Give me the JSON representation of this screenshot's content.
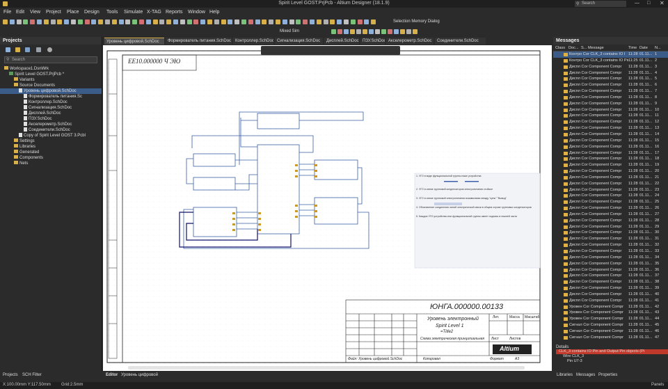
{
  "window": {
    "title": "Spirit Level GOST.PrjPcb - Altium Designer (18.1.9)",
    "search_label": "Search"
  },
  "menu": [
    "File",
    "Edit",
    "View",
    "Project",
    "Place",
    "Design",
    "Tools",
    "Simulate",
    "X-TAG",
    "Reports",
    "Window",
    "Help"
  ],
  "toolbar": {
    "selection_memory": "Selection Memory Dialog",
    "mixed_sim": "Mixed Sim"
  },
  "projects_panel": {
    "title": "Projects",
    "search_placeholder": "Search",
    "tree": [
      {
        "label": "Workspace1.DsnWrk",
        "indent": 0,
        "type": "ws"
      },
      {
        "label": "Spirit Level GOST.PrjPcb *",
        "indent": 1,
        "type": "proj"
      },
      {
        "label": "Variants",
        "indent": 2,
        "type": "folder"
      },
      {
        "label": "Source Documents",
        "indent": 2,
        "type": "folder"
      },
      {
        "label": "Уровень цифровой.SchDoc",
        "indent": 3,
        "type": "doc",
        "selected": true
      },
      {
        "label": "Формирователь питания.Sc",
        "indent": 4,
        "type": "doc"
      },
      {
        "label": "Контроллер.SchDoc",
        "indent": 4,
        "type": "doc"
      },
      {
        "label": "Сигнализация.SchDoc",
        "indent": 4,
        "type": "doc"
      },
      {
        "label": "Дисплей.SchDoc",
        "indent": 4,
        "type": "doc"
      },
      {
        "label": "ПЗУ.SchDoc",
        "indent": 4,
        "type": "doc"
      },
      {
        "label": "Акселерометр.SchDoc",
        "indent": 4,
        "type": "doc"
      },
      {
        "label": "Соединители.SchDoc",
        "indent": 4,
        "type": "doc"
      },
      {
        "label": "Copy of Spirit Level GOST 3.Pcbl",
        "indent": 3,
        "type": "doc"
      },
      {
        "label": "Settings",
        "indent": 2,
        "type": "folder"
      },
      {
        "label": "Libraries",
        "indent": 2,
        "type": "folder"
      },
      {
        "label": "Generated",
        "indent": 2,
        "type": "folder"
      },
      {
        "label": "Components",
        "indent": 2,
        "type": "folder"
      },
      {
        "label": "Nets",
        "indent": 2,
        "type": "folder"
      }
    ]
  },
  "doc_tabs": [
    "Уровень цифровой.SchDoc",
    "Формирователь питания.SchDoc",
    "Контроллер.SchDoc",
    "Сигнализация.SchDoc",
    "Дисплей.SchDoc",
    "ПЗУ.SchDoc",
    "Акселерометр.SchDoc",
    "Соединители.SchDoc"
  ],
  "sheet": {
    "doc_code_rot": "ЕЕ10.000000 Ч ЭЮ",
    "title_block_code": "ЮНГА.000000.00133",
    "title_name": "Уровень электронный",
    "title_sub": "Spirit Level 1",
    "title_file": "=Title2",
    "title_desc": "Схема электрическая принципиальная",
    "col_lit": "Лит.",
    "col_mass": "Масса",
    "col_scale": "Масштаб",
    "col_sheet": "Лист",
    "col_sheets": "Листов",
    "logo": "Altium",
    "footer_file": "Файл: Уровень цифровой.SchDoc",
    "footer_copied": "Копировал",
    "footer_format": "Формат",
    "footer_format_val": "A3",
    "notes": [
      "1. УГО в виде функциональной группы ниже устройства",
      "2. УГО в схеме групповой конденсаторов электропитания стойкое",
      "3. УГО в схеме групповой электропитания взаимосвязи между \"цепь\" \"Вывод\"",
      "4. Обозначение соединения линий электрической связи в общем случае групповых конденсаторов",
      "5. Каждое УГО устройства или функциональной группы имеет подпись в нижней части"
    ]
  },
  "messages_panel": {
    "title": "Messages",
    "columns": [
      "Class",
      "Doc...",
      "S...",
      "Message",
      "Time",
      "Date",
      "N..."
    ],
    "rows": [
      {
        "msg": "Контро Cor CLK_3 contains IO I",
        "time": "11:28",
        "date": "01.11...",
        "no": "1"
      },
      {
        "msg": "Контро Cor CLK_3 contains IO Pin",
        "time": "11:25",
        "date": "01.11...",
        "no": "2"
      },
      {
        "msg": "Диспл Cor Component Compr",
        "time": "11:28",
        "date": "01.11...",
        "no": "3"
      },
      {
        "msg": "Диспл Cor Component Compr",
        "time": "11:28",
        "date": "01.11...",
        "no": "4"
      },
      {
        "msg": "Диспл Cor Component Compr",
        "time": "11:28",
        "date": "01.11...",
        "no": "5"
      },
      {
        "msg": "Диспл Cor Component Compr",
        "time": "11:28",
        "date": "01.11...",
        "no": "6"
      },
      {
        "msg": "Диспл Cor Component Compr",
        "time": "11:28",
        "date": "01.11...",
        "no": "7"
      },
      {
        "msg": "Диспл Cor Component Compr",
        "time": "11:28",
        "date": "01.11...",
        "no": "8"
      },
      {
        "msg": "Диспл Cor Component Compr",
        "time": "11:28",
        "date": "01.11...",
        "no": "9"
      },
      {
        "msg": "Диспл Cor Component Compr",
        "time": "11:28",
        "date": "01.11...",
        "no": "10"
      },
      {
        "msg": "Диспл Cor Component Compr",
        "time": "11:28",
        "date": "01.11...",
        "no": "11"
      },
      {
        "msg": "Диспл Cor Component Compr",
        "time": "11:28",
        "date": "01.11...",
        "no": "12"
      },
      {
        "msg": "Диспл Cor Component Compr",
        "time": "11:28",
        "date": "01.11...",
        "no": "13"
      },
      {
        "msg": "Диспл Cor Component Compr",
        "time": "11:28",
        "date": "01.11...",
        "no": "14"
      },
      {
        "msg": "Диспл Cor Component Compr",
        "time": "11:28",
        "date": "01.11...",
        "no": "15"
      },
      {
        "msg": "Диспл Cor Component Compr",
        "time": "11:28",
        "date": "01.11...",
        "no": "16"
      },
      {
        "msg": "Диспл Cor Component Compr",
        "time": "11:28",
        "date": "01.11...",
        "no": "17"
      },
      {
        "msg": "Диспл Cor Component Compr",
        "time": "11:28",
        "date": "01.11...",
        "no": "18"
      },
      {
        "msg": "Диспл Cor Component Compr",
        "time": "11:28",
        "date": "01.11...",
        "no": "19"
      },
      {
        "msg": "Диспл Cor Component Compr",
        "time": "11:28",
        "date": "01.11...",
        "no": "20"
      },
      {
        "msg": "Диспл Cor Component Compr",
        "time": "11:28",
        "date": "01.11...",
        "no": "21"
      },
      {
        "msg": "Диспл Cor Component Compr",
        "time": "11:28",
        "date": "01.11...",
        "no": "22"
      },
      {
        "msg": "Диспл Cor Component Compr",
        "time": "11:28",
        "date": "01.11...",
        "no": "23"
      },
      {
        "msg": "Диспл Cor Component Compr",
        "time": "11:28",
        "date": "01.11...",
        "no": "24"
      },
      {
        "msg": "Диспл Cor Component Compr",
        "time": "11:28",
        "date": "01.11...",
        "no": "25"
      },
      {
        "msg": "Диспл Cor Component Compr",
        "time": "11:28",
        "date": "01.11...",
        "no": "26"
      },
      {
        "msg": "Диспл Cor Component Compr",
        "time": "11:28",
        "date": "01.11...",
        "no": "27"
      },
      {
        "msg": "Диспл Cor Component Compr",
        "time": "11:28",
        "date": "01.11...",
        "no": "28"
      },
      {
        "msg": "Диспл Cor Component Compr",
        "time": "11:28",
        "date": "01.11...",
        "no": "29"
      },
      {
        "msg": "Диспл Cor Component Compr",
        "time": "11:28",
        "date": "01.11...",
        "no": "30"
      },
      {
        "msg": "Диспл Cor Component Compr",
        "time": "11:28",
        "date": "01.11...",
        "no": "31"
      },
      {
        "msg": "Диспл Cor Component Compr",
        "time": "11:28",
        "date": "01.11...",
        "no": "32"
      },
      {
        "msg": "Диспл Cor Component Compr",
        "time": "11:28",
        "date": "01.11...",
        "no": "33"
      },
      {
        "msg": "Диспл Cor Component Compr",
        "time": "11:28",
        "date": "01.11...",
        "no": "34"
      },
      {
        "msg": "Диспл Cor Component Compr",
        "time": "11:28",
        "date": "01.11...",
        "no": "35"
      },
      {
        "msg": "Диспл Cor Component Compr",
        "time": "11:28",
        "date": "01.11...",
        "no": "36"
      },
      {
        "msg": "Диспл Cor Component Compr",
        "time": "11:28",
        "date": "01.11...",
        "no": "37"
      },
      {
        "msg": "Диспл Cor Component Compr",
        "time": "11:28",
        "date": "01.11...",
        "no": "38"
      },
      {
        "msg": "Диспл Cor Component Compr",
        "time": "11:28",
        "date": "01.11...",
        "no": "39"
      },
      {
        "msg": "Диспл Cor Component Compr",
        "time": "11:28",
        "date": "01.11...",
        "no": "40"
      },
      {
        "msg": "Диспл Cor Component Compr",
        "time": "11:28",
        "date": "01.11...",
        "no": "41"
      },
      {
        "msg": "Уровен Cor Component Compr",
        "time": "11:28",
        "date": "01.11...",
        "no": "42"
      },
      {
        "msg": "Уровен Cor Component Compr",
        "time": "11:28",
        "date": "01.11...",
        "no": "43"
      },
      {
        "msg": "Уровен Cor Component Compr",
        "time": "11:28",
        "date": "01.11...",
        "no": "44"
      },
      {
        "msg": "Сигнал Cor Component Compr",
        "time": "11:28",
        "date": "01.11...",
        "no": "45"
      },
      {
        "msg": "Сигнал Cor Component Compr",
        "time": "11:28",
        "date": "01.11...",
        "no": "46"
      },
      {
        "msg": "Сигнал Cor Component Compr",
        "time": "11:28",
        "date": "01.11...",
        "no": "47"
      }
    ],
    "details_title": "Details",
    "details": [
      "CLK_3 contains IO Pin and Output Pin objects (Pi",
      "Wire CLK_3",
      "Pin U7-3"
    ]
  },
  "bottom_tabs_left": [
    "Projects",
    "SCH Filter"
  ],
  "bottom_tabs_center": [
    "Editor",
    "Уровень цифровой"
  ],
  "bottom_tabs_right": [
    "Libraries",
    "Messages",
    "Properties"
  ],
  "status": {
    "coords": "X:100.00mm Y:117.50mm",
    "grid": "Grid:2.5mm",
    "panels": "Panels"
  },
  "colors": {
    "bg": "#2b2b2b",
    "accent": "#d8b04a",
    "wire": "#000080",
    "error_row": "#c0392b"
  }
}
